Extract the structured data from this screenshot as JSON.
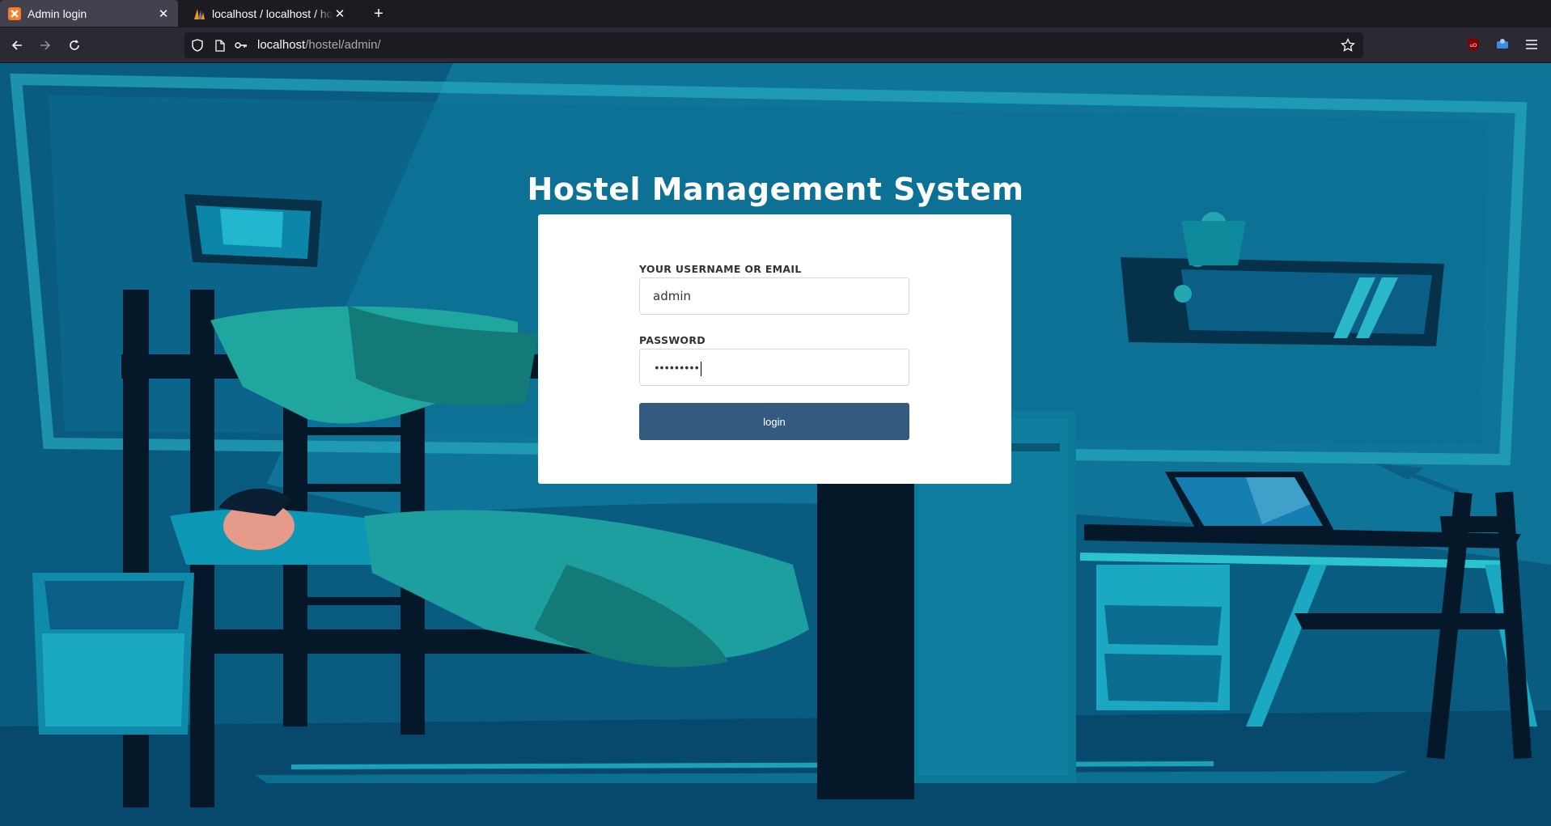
{
  "browser": {
    "tabs": [
      {
        "title": "Admin login",
        "active": true,
        "favicon": "xampp-icon"
      },
      {
        "title": "localhost / localhost / hostel",
        "active": false,
        "favicon": "phpmyadmin-icon"
      }
    ],
    "url_host": "localhost",
    "url_path": "/hostel/admin/",
    "accent": "#42414d"
  },
  "page": {
    "title": "Hostel Management System",
    "form": {
      "username_label": "YOUR USERNAME OR EMAIL",
      "username_value": "admin",
      "password_label": "PASSWORD",
      "password_masked": "•••••••••",
      "login_label": "login",
      "button_color": "#355a80"
    }
  }
}
